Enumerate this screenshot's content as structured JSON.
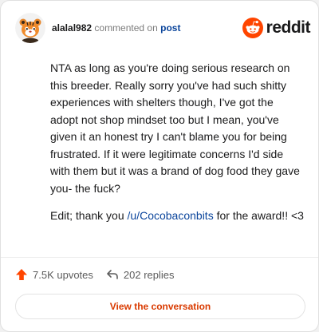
{
  "header": {
    "username": "alalal982",
    "action_text": "commented on",
    "post_link": "post",
    "brand_name": "reddit",
    "avatar_icon": "snoo-tiger-avatar-icon",
    "logo_icon": "reddit-snoo-logo-icon"
  },
  "comment": {
    "paragraph1": "NTA as long as you're doing serious research on this breeder. Really sorry you've had such shitty experiences with shelters though, I've got the adopt not shop mindset too but I mean, you've given it an honest try I can't blame you for being frustrated. If it were legitimate concerns I'd side with them but it was a brand of dog food they gave you- the fuck?",
    "paragraph2_before": "Edit; thank you ",
    "paragraph2_link": "/u/Cocobaconbits",
    "paragraph2_after": " for the award!! <3"
  },
  "footer": {
    "upvotes": "7.5K upvotes",
    "replies": "202 replies",
    "upvote_icon": "upvote-arrow-icon",
    "reply_icon": "reply-arrow-icon",
    "cta_label": "View the conversation"
  },
  "colors": {
    "brand": "#ff4500",
    "link": "#0a449b",
    "cta_text": "#d93a00"
  }
}
